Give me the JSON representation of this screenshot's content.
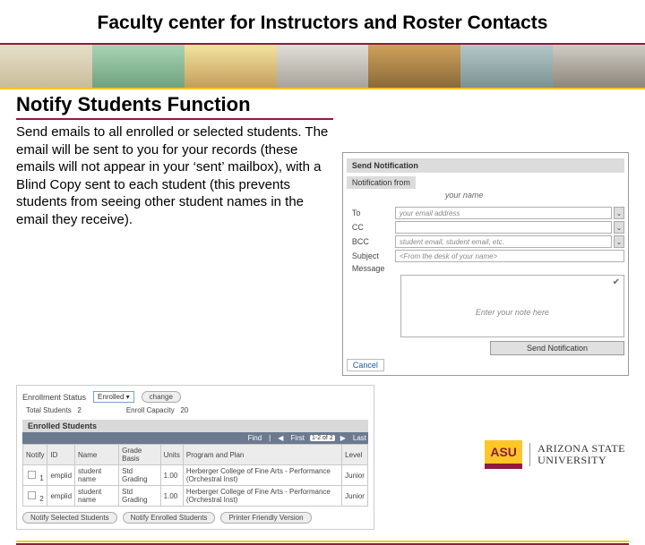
{
  "title": "Faculty center for Instructors and Roster Contacts",
  "subheading": "Notify Students Function",
  "body": "Send emails to all enrolled or selected students.  The email will be sent to you for your records (these emails will not appear in your ‘sent’ mailbox), with a Blind Copy sent to each student (this prevents students from seeing other student names in the email they receive).",
  "form": {
    "header": "Send Notification",
    "from_label": "Notification from",
    "from_value": "your name",
    "to_label": "To",
    "to_value": "your email address",
    "cc_label": "CC",
    "bcc_label": "BCC",
    "bcc_value": "student email, student email, etc.",
    "subject_label": "Subject",
    "subject_value": "<From the desk of   your name>",
    "message_label": "Message",
    "message_placeholder": "Enter your note here",
    "send_button": "Send Notification",
    "cancel": "Cancel"
  },
  "roster": {
    "status_label": "Enrollment Status",
    "status_value": "Enrolled",
    "change": "change",
    "total_label": "Total Students",
    "total_value": "2",
    "capacity_label": "Enroll Capacity",
    "capacity_value": "20",
    "bar": "Enrolled Students",
    "find": "Find",
    "first": "First",
    "range": "1-2 of 2",
    "last": "Last",
    "headers": {
      "notify": "Notify",
      "id": "ID",
      "name": "Name",
      "grade_basis": "Grade Basis",
      "units": "Units",
      "program": "Program and Plan",
      "level": "Level"
    },
    "rows": [
      {
        "id": "emplid",
        "name": "student name",
        "grade_basis": "Std Grading",
        "units": "1.00",
        "program": "Herberger College of Fine Arts - Performance (Orchestral Inst)",
        "level": "Junior"
      },
      {
        "id": "emplid",
        "name": "student name",
        "grade_basis": "Std Grading",
        "units": "1.00",
        "program": "Herberger College of Fine Arts - Performance (Orchestral Inst)",
        "level": "Junior"
      }
    ],
    "actions": {
      "notify_selected": "Notify Selected Students",
      "notify_enrolled": "Notify Enrolled Students",
      "printer": "Printer Friendly Version"
    }
  },
  "logo": {
    "mark": "ASU",
    "line1": "ARIZONA STATE",
    "line2": "UNIVERSITY"
  }
}
